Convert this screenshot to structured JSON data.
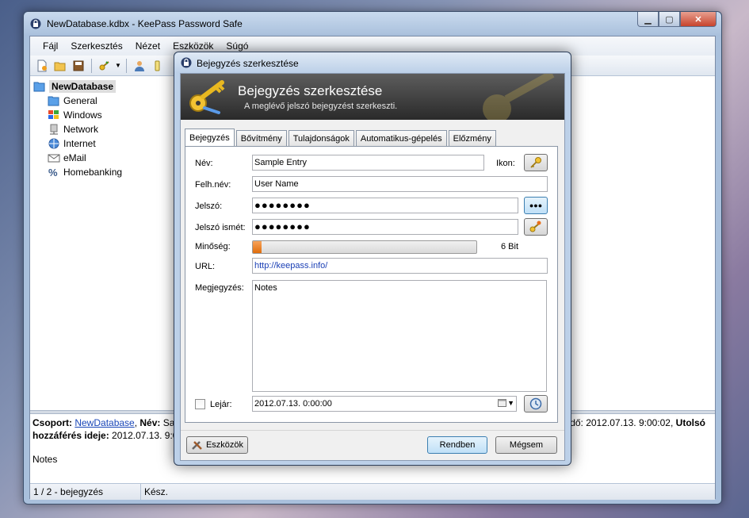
{
  "main_window": {
    "title": "NewDatabase.kdbx - KeePass Password Safe",
    "menu": [
      "Fájl",
      "Szerkesztés",
      "Nézet",
      "Eszközök",
      "Súgó"
    ],
    "tree": {
      "root": "NewDatabase",
      "groups": [
        "General",
        "Windows",
        "Network",
        "Internet",
        "eMail",
        "Homebanking"
      ]
    },
    "info": {
      "group_label": "Csoport:",
      "group_value": "NewDatabase",
      "name_label": "Név:",
      "name_value": "Sam",
      "modified_tail": "idő: 2012.07.13. 9:00:02,",
      "last_label": "Utolsó",
      "access_label": "hozzáférés ideje:",
      "access_value": "2012.07.13. 9:00",
      "notes": "Notes"
    },
    "status": {
      "count": "1 / 2 - bejegyzés",
      "state": "Kész."
    }
  },
  "dialog": {
    "title": "Bejegyzés szerkesztése",
    "banner_title": "Bejegyzés szerkesztése",
    "banner_subtitle": "A meglévő jelszó bejegyzést szerkeszti.",
    "tabs": [
      "Bejegyzés",
      "Bővítmény",
      "Tulajdonságok",
      "Automatikus-gépelés",
      "Előzmény"
    ],
    "fields": {
      "name_label": "Név:",
      "name_value": "Sample Entry",
      "icon_label": "Ikon:",
      "user_label": "Felh.név:",
      "user_value": "User Name",
      "pw_label": "Jelszó:",
      "pw_value": "●●●●●●●●",
      "pw_repeat_label": "Jelszó ismét:",
      "pw_repeat_value": "●●●●●●●●",
      "show_pw_button": "●●●",
      "quality_label": "Minőség:",
      "quality_text": "6 Bit",
      "quality_fraction": 0.04,
      "url_label": "URL:",
      "url_value": "http://keepass.info/",
      "notes_label": "Megjegyzés:",
      "notes_value": "Notes",
      "expires_label": "Lejár:",
      "expires_value": "2012.07.13.   0:00:00"
    },
    "buttons": {
      "tools": "Eszközök",
      "ok": "Rendben",
      "cancel": "Mégsem"
    }
  },
  "colors": {
    "banner_dark": "#2a2a2a",
    "quality_orange": "#e06d0c",
    "url_blue": "#1a3fb5",
    "link_blue": "#1a47b8"
  }
}
